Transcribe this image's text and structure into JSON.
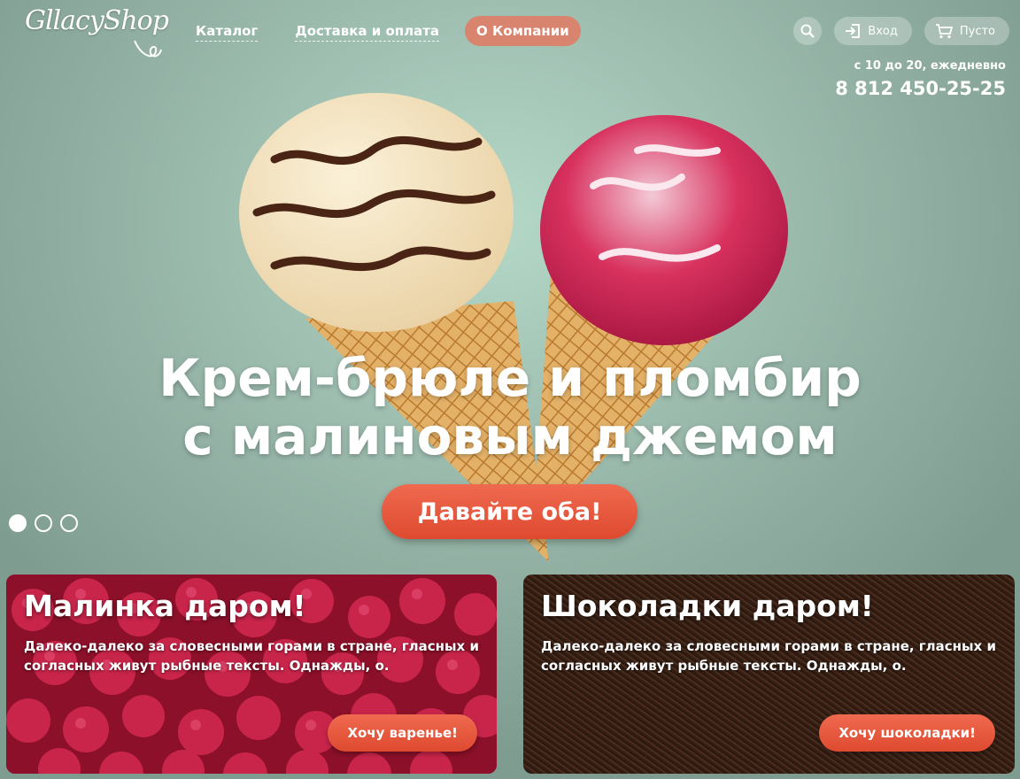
{
  "logo": {
    "text": "GllacyShop"
  },
  "nav": [
    {
      "label": "Каталог"
    },
    {
      "label": "Доставка и оплата"
    },
    {
      "label": "О Компании"
    }
  ],
  "header": {
    "login_label": "Вход",
    "cart_label": "Пусто",
    "hours": "с 10 до 20, ежедневно",
    "phone": "8 812 450-25-25"
  },
  "hero": {
    "title_line1": "Крем-брюле и пломбир",
    "title_line2": "с малиновым джемом",
    "cta": "Давайте оба!",
    "slides_active": 1,
    "slides_total": 3
  },
  "promos": [
    {
      "title": "Малинка даром!",
      "text": "Далеко-далеко за словесными горами в стране, гласных и согласных живут рыбные тексты. Однажды, о.",
      "button": "Хочу варенье!"
    },
    {
      "title": "Шоколадки даром!",
      "text": "Далеко-далеко за словесными горами в стране, гласных и согласных живут рыбные тексты. Однажды, о.",
      "button": "Хочу шоколадки!"
    }
  ],
  "colors": {
    "accent": "#e2553a",
    "active_nav": "#d9846f",
    "background": "#9cbcae"
  }
}
